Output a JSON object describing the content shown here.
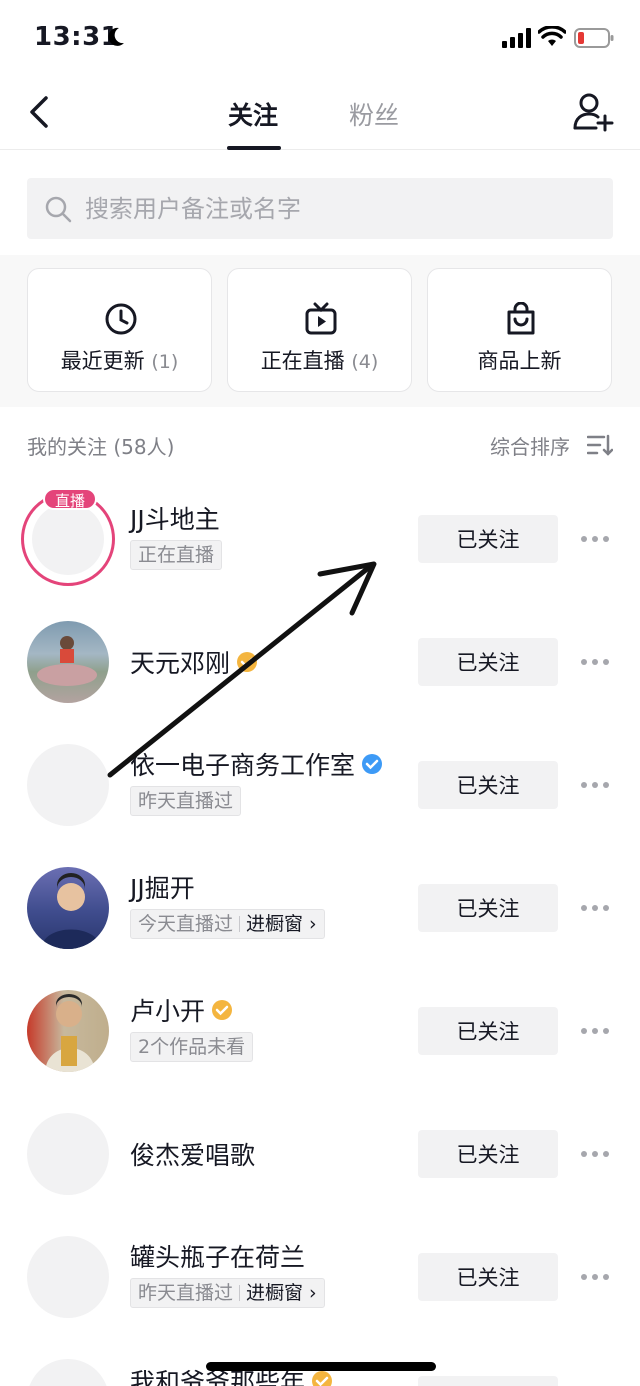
{
  "status_bar": {
    "time": "13:31"
  },
  "nav": {
    "tab_following": "关注",
    "tab_fans": "粉丝"
  },
  "search": {
    "placeholder": "搜索用户备注或名字"
  },
  "cards": [
    {
      "label": "最近更新",
      "count": "(1)",
      "icon": "clock-icon"
    },
    {
      "label": "正在直播",
      "count": "(4)",
      "icon": "tv-icon"
    },
    {
      "label": "商品上新",
      "count": "",
      "icon": "shopping-bag-icon"
    }
  ],
  "list": {
    "title": "我的关注 (58人)",
    "sort_label": "综合排序"
  },
  "users": [
    {
      "name": "JJ斗地主",
      "live_badge": "直播",
      "tag": "正在直播",
      "follow": "已关注"
    },
    {
      "name": "天元邓刚",
      "verified": "gold",
      "follow": "已关注"
    },
    {
      "name": "依一电子商务工作室",
      "verified": "blue",
      "tag": "昨天直播过",
      "follow": "已关注"
    },
    {
      "name": "JJ掘开",
      "tag": "今天直播过",
      "tag_shop": "进橱窗 ›",
      "follow": "已关注"
    },
    {
      "name": "卢小开",
      "verified": "gold",
      "tag": "2个作品未看",
      "follow": "已关注"
    },
    {
      "name": "俊杰爱唱歌",
      "follow": "已关注"
    },
    {
      "name": "罐头瓶子在荷兰",
      "tag": "昨天直播过",
      "tag_shop": "进橱窗 ›",
      "follow": "已关注"
    },
    {
      "name": "我和爷爷那些年",
      "verified": "gold"
    }
  ],
  "colors": {
    "live_pink": "#e4447a",
    "verify_gold": "#f4b53f",
    "verify_blue": "#3d9af6"
  }
}
